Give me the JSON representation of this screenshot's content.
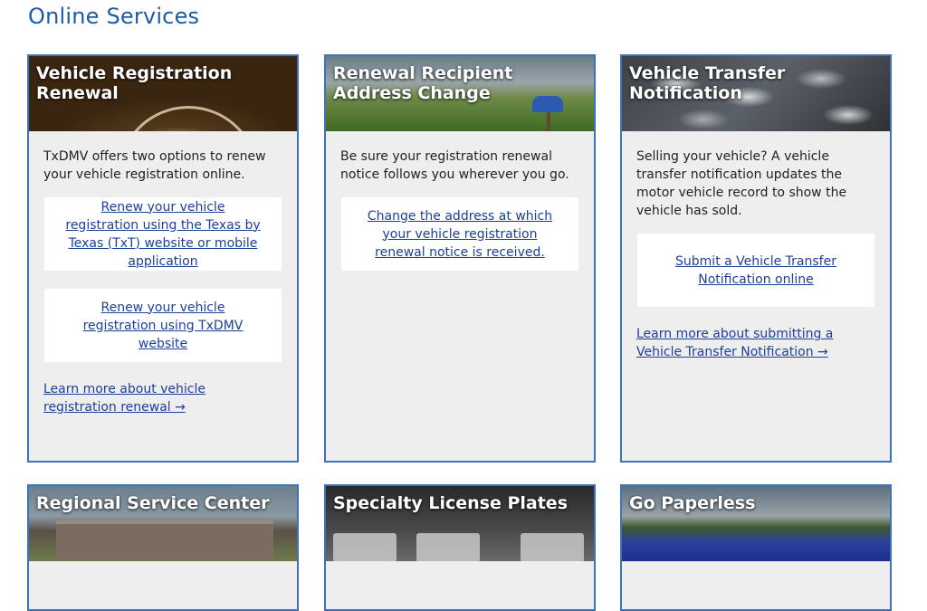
{
  "page": {
    "title": "Online Services"
  },
  "cards": [
    {
      "title": "Vehicle Registration Renewal",
      "description": "TxDMV offers two options to renew your vehicle registration online.",
      "links": [
        "Renew your vehicle registration using the Texas by Texas (TxT) website or mobile application",
        "Renew your vehicle registration using TxDMV website"
      ],
      "learn_more": "Learn more about vehicle registration renewal →"
    },
    {
      "title": "Renewal Recipient Address Change",
      "description": "Be sure your registration renewal notice follows you wherever you go.",
      "links": [
        "Change the address at which your vehicle registration renewal notice is received."
      ]
    },
    {
      "title": "Vehicle Transfer Notification",
      "description": "Selling your vehicle? A vehicle transfer notification updates the motor vehicle record to show the vehicle has sold.",
      "links": [
        "Submit a Vehicle Transfer Notification online"
      ],
      "learn_more": "Learn more about submitting a Vehicle Transfer Notification →"
    },
    {
      "title": "Regional Service Center"
    },
    {
      "title": "Specialty License Plates"
    },
    {
      "title": "Go Paperless"
    }
  ],
  "colors": {
    "accent": "#1f5aa6",
    "card_border": "#3f72b8",
    "card_bg": "#eeeeee",
    "link": "#1d3f9a"
  }
}
